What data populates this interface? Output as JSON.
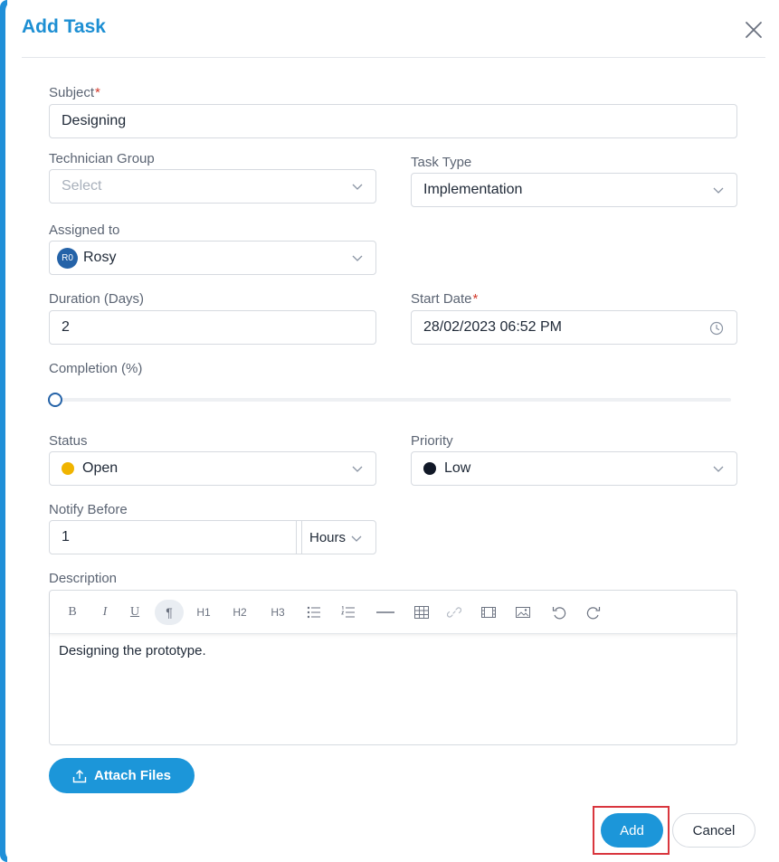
{
  "modal": {
    "title": "Add Task",
    "add_label": "Add",
    "cancel_label": "Cancel",
    "attach_label": "Attach Files"
  },
  "form": {
    "subject": {
      "label": "Subject",
      "required_mark": "*",
      "value": "Designing"
    },
    "technician_group": {
      "label": "Technician Group",
      "placeholder": "Select"
    },
    "task_type": {
      "label": "Task Type",
      "value": "Implementation"
    },
    "assigned_to": {
      "label": "Assigned to",
      "initials": "R0",
      "value": "Rosy"
    },
    "duration": {
      "label": "Duration (Days)",
      "value": "2"
    },
    "start_date": {
      "label": "Start Date",
      "required_mark": "*",
      "value": "28/02/2023 06:52 PM"
    },
    "completion": {
      "label": "Completion (%)",
      "percent": 0
    },
    "status": {
      "label": "Status",
      "value": "Open",
      "color": "#f0b400"
    },
    "priority": {
      "label": "Priority",
      "value": "Low",
      "color": "#111827"
    },
    "notify_before": {
      "label": "Notify Before",
      "value": "1",
      "unit": "Hours"
    },
    "description": {
      "label": "Description",
      "text": "Designing the prototype.",
      "toolbar": [
        "bold",
        "italic",
        "underline",
        "paragraph",
        "H1",
        "H2",
        "H3",
        "bullet-list",
        "numbered-list",
        "horizontal-rule",
        "table",
        "link",
        "video",
        "image",
        "undo",
        "redo"
      ]
    }
  },
  "colors": {
    "accent": "#1c96d9",
    "title": "#1d8fd3",
    "highlight": "#d9363e",
    "avatar": "#2563a8"
  }
}
